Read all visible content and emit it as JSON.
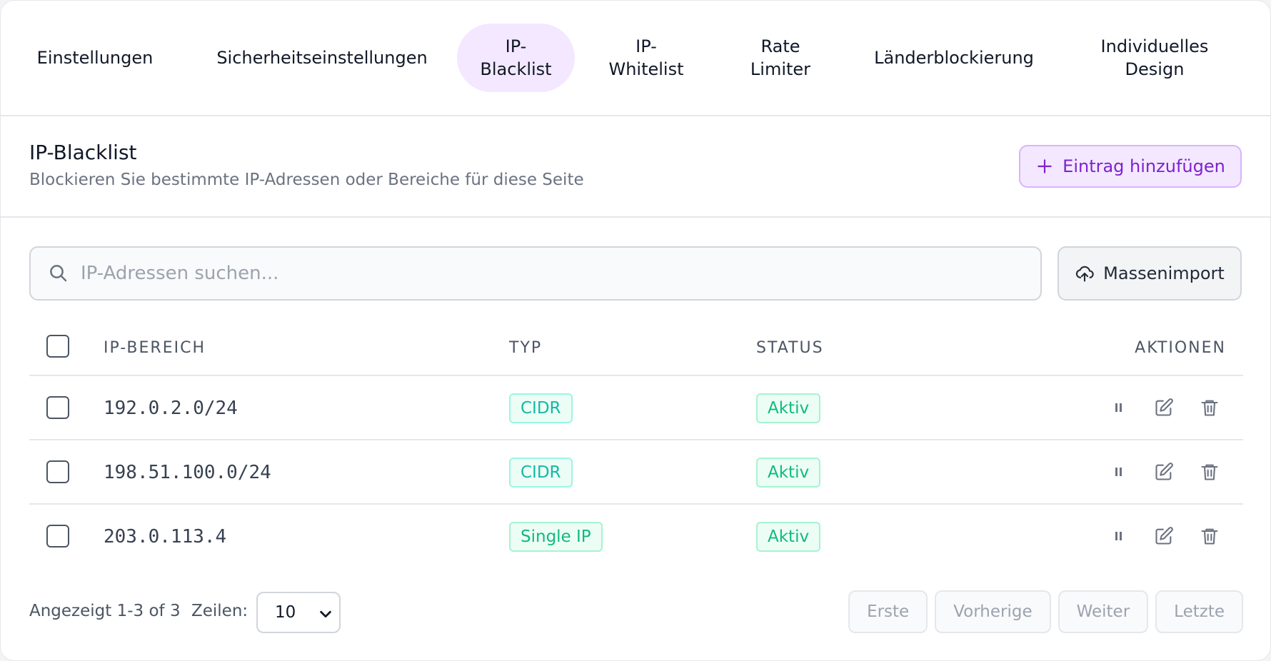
{
  "tabs": [
    {
      "label": "Einstellungen",
      "active": false
    },
    {
      "label": "Sicherheitseinstellungen",
      "active": false
    },
    {
      "label_line1": "IP-",
      "label_line2": "Blacklist",
      "active": true
    },
    {
      "label_line1": "IP-",
      "label_line2": "Whitelist",
      "active": false
    },
    {
      "label_line1": "Rate",
      "label_line2": "Limiter",
      "active": false
    },
    {
      "label": "Länderblockierung",
      "active": false
    },
    {
      "label_line1": "Individuelles",
      "label_line2": "Design",
      "active": false
    }
  ],
  "header": {
    "title": "IP-Blacklist",
    "subtitle": "Blockieren Sie bestimmte IP-Adressen oder Bereiche für diese Seite",
    "add_label": "Eintrag hinzufügen"
  },
  "search": {
    "placeholder": "IP-Adressen suchen...",
    "value": "",
    "import_label": "Massenimport"
  },
  "table": {
    "columns": [
      "IP-BEREICH",
      "TYP",
      "STATUS",
      "AKTIONEN"
    ],
    "rows": [
      {
        "ip": "192.0.2.0/24",
        "type": "CIDR",
        "status": "Aktiv"
      },
      {
        "ip": "198.51.100.0/24",
        "type": "CIDR",
        "status": "Aktiv"
      },
      {
        "ip": "203.0.113.4",
        "type": "Single IP",
        "status": "Aktiv"
      }
    ]
  },
  "footer": {
    "shown": "Angezeigt 1-3 of 3",
    "rows_label": "Zeilen:",
    "rows_value": "10",
    "first": "Erste",
    "previous": "Vorherige",
    "next": "Weiter",
    "last": "Letzte"
  },
  "colors": {
    "accent": "#7e22ce",
    "accent_bg": "#f3e8ff",
    "status_green": "#10b981",
    "type_teal": "#14b8a6"
  },
  "icons": {
    "add": "plus-icon",
    "search": "search-icon",
    "import": "upload-cloud-icon",
    "pause": "pause-icon",
    "edit": "edit-icon",
    "delete": "trash-icon",
    "select": "chevron-down-icon"
  }
}
